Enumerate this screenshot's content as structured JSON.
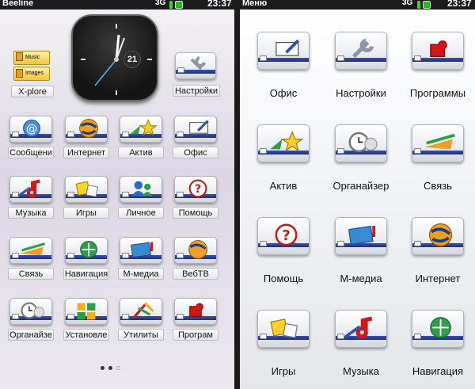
{
  "left": {
    "status": {
      "carrier": "Beeline",
      "network": "3G",
      "time": "23:37"
    },
    "clock_date": "21",
    "xplore": {
      "label": "X-plore",
      "music": "Music",
      "images": "Images"
    },
    "settings_label": "Настройки",
    "grid": [
      "Сообщени",
      "Интернет",
      "Актив",
      "Офис",
      "Музыка",
      "Игры",
      "Личное",
      "Помощь",
      "Связь",
      "Навигация",
      "М-медиа",
      "ВебТВ",
      "Органайзе",
      "Установле",
      "Утилиты",
      "Програм"
    ],
    "page_dots": [
      "",
      "",
      ""
    ]
  },
  "right": {
    "status": {
      "title": "Меню",
      "network": "3G",
      "time": "23:37"
    },
    "grid": [
      "Офис",
      "Настройки",
      "Программы",
      "Актив",
      "Органайзер",
      "Связь",
      "Помощь",
      "М-медиа",
      "Интернет",
      "Игры",
      "Музыка",
      "Навигация"
    ]
  },
  "colors": {
    "stripe": "#1f2f7a",
    "status_bg": "#1c1c1c",
    "signal": "#3fd23a"
  }
}
